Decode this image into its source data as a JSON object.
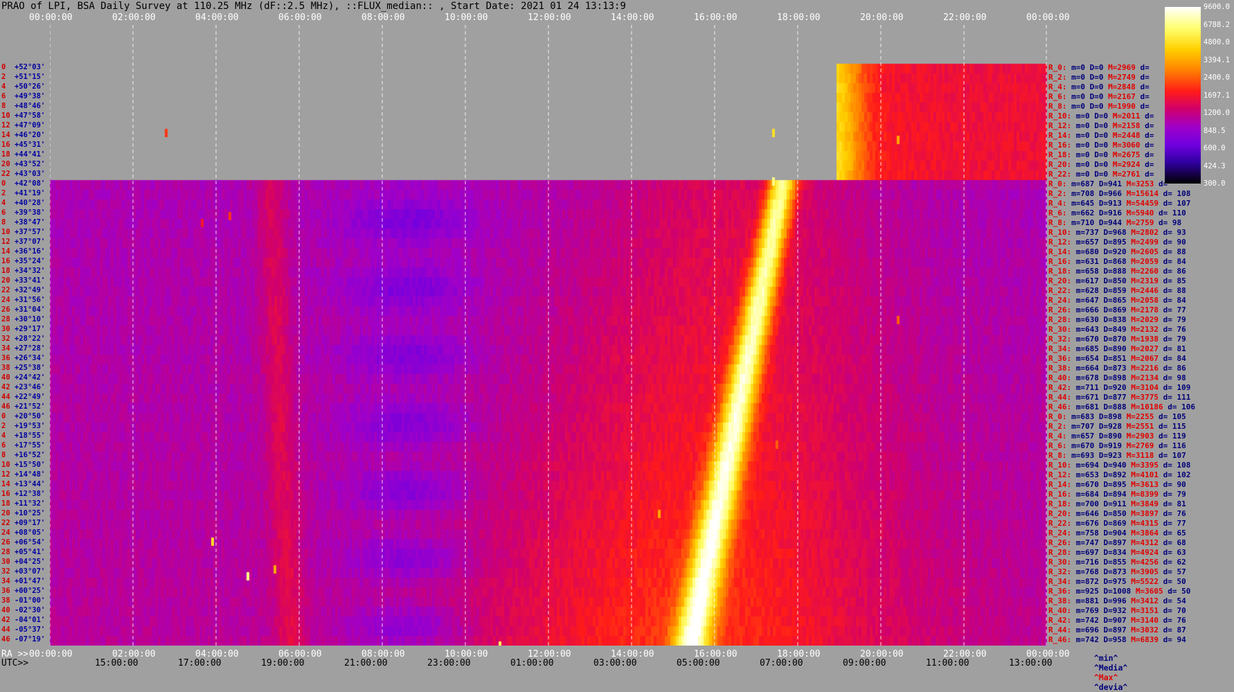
{
  "title": "PRAO of LPI, BSA Daily Survey at 110.25 MHz (dF::2.5 MHz), ::FLUX_median:: , Start Date: 2021 01 24 13:13:9",
  "top_ticks": [
    "00:00:00",
    "02:00:00",
    "04:00:00",
    "06:00:00",
    "08:00:00",
    "10:00:00",
    "12:00:00",
    "14:00:00",
    "16:00:00",
    "18:00:00",
    "20:00:00",
    "22:00:00",
    "00:00:00"
  ],
  "bottom_ra_label": "RA >>",
  "bottom_utc_label": "UTC>>",
  "bottom_ticks_ra": [
    "00:00:00",
    "02:00:00",
    "04:00:00",
    "06:00:00",
    "08:00:00",
    "10:00:00",
    "12:00:00",
    "14:00:00",
    "16:00:00",
    "18:00:00",
    "20:00:00",
    "22:00:00",
    "00:00:00"
  ],
  "bottom_ticks_utc": [
    "15:00:00",
    "17:00:00",
    "19:00:00",
    "21:00:00",
    "23:00:00",
    "01:00:00",
    "03:00:00",
    "05:00:00",
    "07:00:00",
    "09:00:00",
    "11:00:00",
    "13:00:00"
  ],
  "colorbar_ticks": [
    "9600.0",
    "6788.2",
    "4800.0",
    "3394.1",
    "2400.0",
    "1697.1",
    "1200.0",
    "848.5",
    "600.0",
    "424.3",
    "300.0"
  ],
  "legend_labels": [
    "^min^",
    "^Media^",
    "^Max^",
    "^devia^"
  ],
  "colors": {
    "background": "#a0a0a0",
    "name_red": "#e00000",
    "value_navy": "#00007a"
  },
  "chart_data": {
    "type": "heatmap",
    "title": "PRAO of LPI, BSA Daily Survey at 110.25 MHz (dF::2.5 MHz), ::FLUX_median:: , Start Date: 2021 01 24 13:13:9",
    "x_unit": "RA / UTC hours",
    "colorscale_range": [
      300.0,
      9600.0
    ],
    "colorscale": "log, black-violet-red-yellow-white",
    "declinations": [
      "+52°03'",
      "+51°15'",
      "+50°26'",
      "+49°38'",
      "+48°46'",
      "+47°58'",
      "+47°09'",
      "+46°20'",
      "+45°31'",
      "+44°41'",
      "+43°52'",
      "+43°03'",
      "+42°08'",
      "+41°19'",
      "+40°28'",
      "+39°38'",
      "+38°47'",
      "+37°57'",
      "+37°07'",
      "+36°16'",
      "+35°24'",
      "+34°32'",
      "+33°41'",
      "+32°49'",
      "+31°56'",
      "+31°04'",
      "+30°10'",
      "+29°17'",
      "+28°22'",
      "+27°28'",
      "+26°34'",
      "+25°38'",
      "+24°42'",
      "+23°46'",
      "+22°49'",
      "+21°52'",
      "+20°50'",
      "+19°53'",
      "+18°55'",
      "+17°55'",
      "+16°52'",
      "+15°50'",
      "+14°48'",
      "+13°44'",
      "+12°38'",
      "+11°32'",
      "+10°25'",
      "+09°17'",
      "+08°05'",
      "+06°54'",
      "+05°41'",
      "+04°25'",
      "+03°07'",
      "+01°47'",
      "+00°25'",
      "-01°00'",
      "-02°30'",
      "-04°01'",
      "-05°37'",
      "-07°19'"
    ],
    "dec_indices": [
      "0",
      "2",
      "4",
      "6",
      "8",
      "10",
      "12",
      "14",
      "16",
      "18",
      "20",
      "22",
      "0",
      "2",
      "4",
      "6",
      "8",
      "10",
      "12",
      "14",
      "16",
      "18",
      "20",
      "22",
      "24",
      "26",
      "28",
      "30",
      "32",
      "34",
      "36",
      "38",
      "40",
      "42",
      "44",
      "46",
      "0",
      "2",
      "4",
      "6",
      "8",
      "10",
      "12",
      "14",
      "16",
      "18",
      "20",
      "22",
      "24",
      "26",
      "28",
      "30",
      "32",
      "34",
      "36",
      "38",
      "40",
      "42",
      "44",
      "46"
    ],
    "row_stats": [
      {
        "name": "R_0:",
        "m": "0",
        "D": "0",
        "M": "2969",
        "d": ""
      },
      {
        "name": "R_2:",
        "m": "0",
        "D": "0",
        "M": "2749",
        "d": ""
      },
      {
        "name": "R_4:",
        "m": "0",
        "D": "0",
        "M": "2848",
        "d": ""
      },
      {
        "name": "R_6:",
        "m": "0",
        "D": "0",
        "M": "2167",
        "d": ""
      },
      {
        "name": "R_8:",
        "m": "0",
        "D": "0",
        "M": "1990",
        "d": ""
      },
      {
        "name": "R_10:",
        "m": "0",
        "D": "0",
        "M": "2011",
        "d": ""
      },
      {
        "name": "R_12:",
        "m": "0",
        "D": "0",
        "M": "2158",
        "d": ""
      },
      {
        "name": "R_14:",
        "m": "0",
        "D": "0",
        "M": "2448",
        "d": ""
      },
      {
        "name": "R_16:",
        "m": "0",
        "D": "0",
        "M": "3060",
        "d": ""
      },
      {
        "name": "R_18:",
        "m": "0",
        "D": "0",
        "M": "2675",
        "d": ""
      },
      {
        "name": "R_20:",
        "m": "0",
        "D": "0",
        "M": "2924",
        "d": ""
      },
      {
        "name": "R_22:",
        "m": "0",
        "D": "0",
        "M": "2761",
        "d": ""
      },
      {
        "name": "R_0:",
        "m": "687",
        "D": "941",
        "M": "3253",
        "d": ""
      },
      {
        "name": "R_2:",
        "m": "708",
        "D": "966",
        "M": "15614",
        "d": "108"
      },
      {
        "name": "R_4:",
        "m": "645",
        "D": "913",
        "M": "54459",
        "d": "107"
      },
      {
        "name": "R_6:",
        "m": "662",
        "D": "916",
        "M": "5940",
        "d": "110"
      },
      {
        "name": "R_8:",
        "m": "710",
        "D": "944",
        "M": "2759",
        "d": "98"
      },
      {
        "name": "R_10:",
        "m": "737",
        "D": "968",
        "M": "2802",
        "d": "93"
      },
      {
        "name": "R_12:",
        "m": "657",
        "D": "895",
        "M": "2499",
        "d": "90"
      },
      {
        "name": "R_14:",
        "m": "680",
        "D": "920",
        "M": "2605",
        "d": "88"
      },
      {
        "name": "R_16:",
        "m": "631",
        "D": "868",
        "M": "2059",
        "d": "84"
      },
      {
        "name": "R_18:",
        "m": "658",
        "D": "888",
        "M": "2260",
        "d": "86"
      },
      {
        "name": "R_20:",
        "m": "617",
        "D": "850",
        "M": "2319",
        "d": "85"
      },
      {
        "name": "R_22:",
        "m": "628",
        "D": "859",
        "M": "2446",
        "d": "88"
      },
      {
        "name": "R_24:",
        "m": "647",
        "D": "865",
        "M": "2058",
        "d": "84"
      },
      {
        "name": "R_26:",
        "m": "666",
        "D": "869",
        "M": "2178",
        "d": "77"
      },
      {
        "name": "R_28:",
        "m": "630",
        "D": "838",
        "M": "2029",
        "d": "79"
      },
      {
        "name": "R_30:",
        "m": "643",
        "D": "849",
        "M": "2132",
        "d": "76"
      },
      {
        "name": "R_32:",
        "m": "670",
        "D": "870",
        "M": "1938",
        "d": "79"
      },
      {
        "name": "R_34:",
        "m": "685",
        "D": "890",
        "M": "2027",
        "d": "81"
      },
      {
        "name": "R_36:",
        "m": "654",
        "D": "851",
        "M": "2067",
        "d": "84"
      },
      {
        "name": "R_38:",
        "m": "664",
        "D": "873",
        "M": "2216",
        "d": "86"
      },
      {
        "name": "R_40:",
        "m": "678",
        "D": "898",
        "M": "2134",
        "d": "98"
      },
      {
        "name": "R_42:",
        "m": "711",
        "D": "920",
        "M": "3104",
        "d": "109"
      },
      {
        "name": "R_44:",
        "m": "671",
        "D": "877",
        "M": "3775",
        "d": "111"
      },
      {
        "name": "R_46:",
        "m": "681",
        "D": "888",
        "M": "10186",
        "d": "106"
      },
      {
        "name": "R_0:",
        "m": "683",
        "D": "898",
        "M": "2255",
        "d": "105"
      },
      {
        "name": "R_2:",
        "m": "707",
        "D": "928",
        "M": "2551",
        "d": "115"
      },
      {
        "name": "R_4:",
        "m": "657",
        "D": "890",
        "M": "2903",
        "d": "119"
      },
      {
        "name": "R_6:",
        "m": "670",
        "D": "919",
        "M": "2769",
        "d": "116"
      },
      {
        "name": "R_8:",
        "m": "693",
        "D": "923",
        "M": "3118",
        "d": "107"
      },
      {
        "name": "R_10:",
        "m": "694",
        "D": "940",
        "M": "3395",
        "d": "108"
      },
      {
        "name": "R_12:",
        "m": "653",
        "D": "892",
        "M": "4101",
        "d": "102"
      },
      {
        "name": "R_14:",
        "m": "670",
        "D": "895",
        "M": "3613",
        "d": "90"
      },
      {
        "name": "R_16:",
        "m": "684",
        "D": "894",
        "M": "8399",
        "d": "79"
      },
      {
        "name": "R_18:",
        "m": "700",
        "D": "911",
        "M": "3849",
        "d": "81"
      },
      {
        "name": "R_20:",
        "m": "646",
        "D": "850",
        "M": "3897",
        "d": "76"
      },
      {
        "name": "R_22:",
        "m": "676",
        "D": "869",
        "M": "4315",
        "d": "77"
      },
      {
        "name": "R_24:",
        "m": "758",
        "D": "904",
        "M": "3864",
        "d": "65"
      },
      {
        "name": "R_26:",
        "m": "747",
        "D": "897",
        "M": "4312",
        "d": "68"
      },
      {
        "name": "R_28:",
        "m": "697",
        "D": "834",
        "M": "4924",
        "d": "63"
      },
      {
        "name": "R_30:",
        "m": "716",
        "D": "855",
        "M": "4256",
        "d": "62"
      },
      {
        "name": "R_32:",
        "m": "768",
        "D": "873",
        "M": "3905",
        "d": "57"
      },
      {
        "name": "R_34:",
        "m": "872",
        "D": "975",
        "M": "5522",
        "d": "50"
      },
      {
        "name": "R_36:",
        "m": "925",
        "D": "1008",
        "M": "3605",
        "d": "50"
      },
      {
        "name": "R_38:",
        "m": "881",
        "D": "996",
        "M": "3412",
        "d": "54"
      },
      {
        "name": "R_40:",
        "m": "769",
        "D": "932",
        "M": "3151",
        "d": "70"
      },
      {
        "name": "R_42:",
        "m": "742",
        "D": "907",
        "M": "3140",
        "d": "76"
      },
      {
        "name": "R_44:",
        "m": "696",
        "D": "897",
        "M": "3032",
        "d": "87"
      },
      {
        "name": "R_46:",
        "m": "742",
        "D": "958",
        "M": "6839",
        "d": "94"
      }
    ]
  }
}
